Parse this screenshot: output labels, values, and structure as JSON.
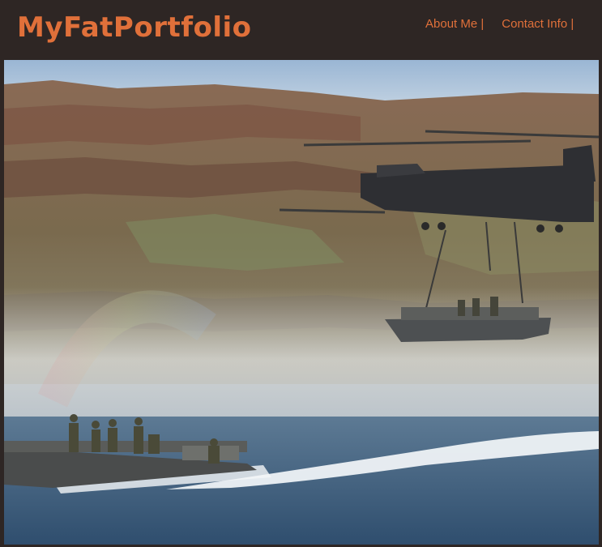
{
  "site": {
    "title": "MyFatPortfolio"
  },
  "nav": {
    "items": [
      {
        "label": "About Me |"
      },
      {
        "label": "Contact Info |"
      }
    ]
  },
  "hero": {
    "image_name": "helicopter-boat-river-photo"
  },
  "colors": {
    "header_bg": "#2e2624",
    "accent": "#e0703a"
  }
}
